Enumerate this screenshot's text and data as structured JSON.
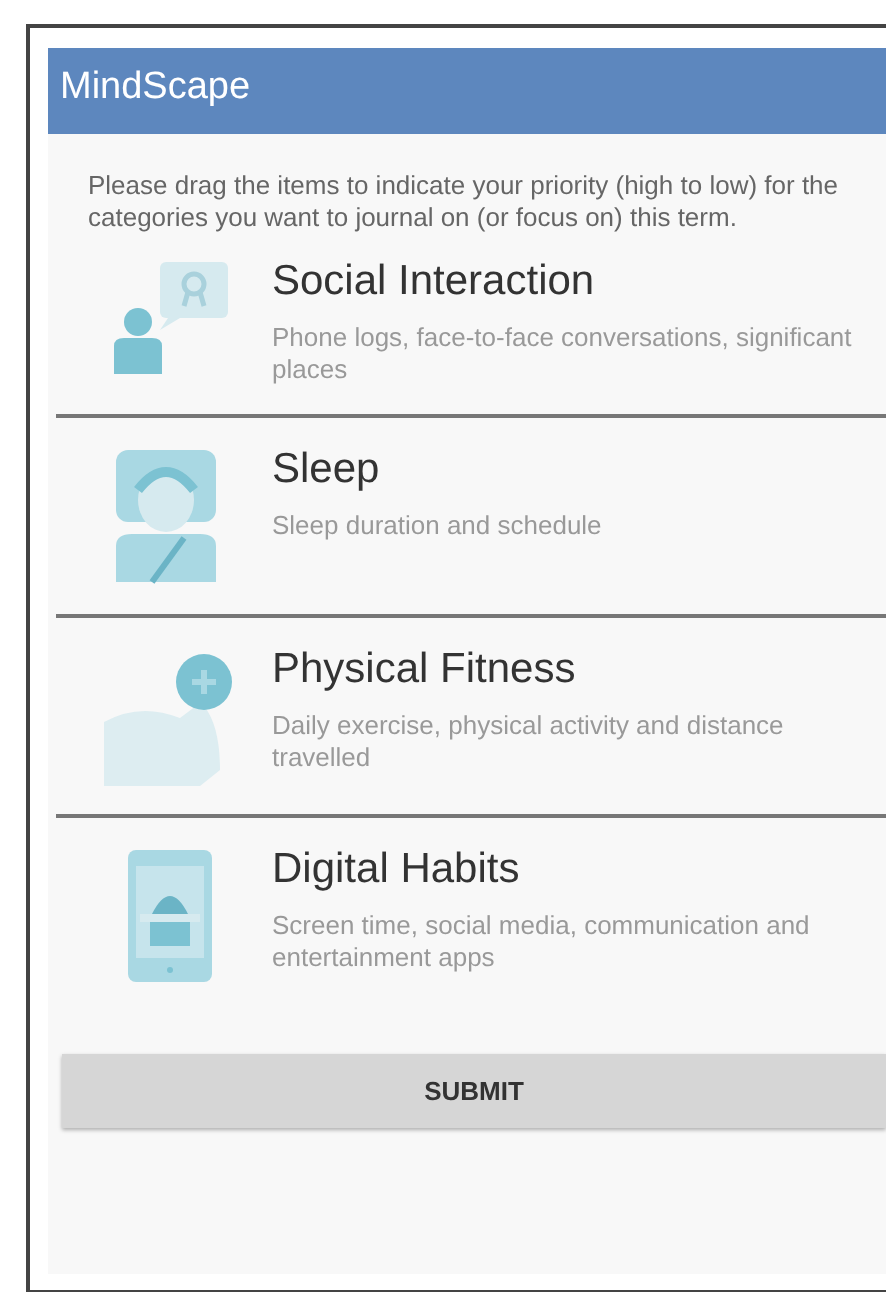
{
  "app_bar": {
    "title": "MindScape"
  },
  "instructions": "Please drag the items to indicate your priority (high to low) for the categories you want to journal on (or focus on) this term.",
  "items": [
    {
      "kind": "social",
      "title": "Social Interaction",
      "description": "Phone logs, face-to-face conversations, significant places"
    },
    {
      "kind": "sleep",
      "title": "Sleep",
      "description": "Sleep duration and schedule"
    },
    {
      "kind": "fitness",
      "title": "Physical Fitness",
      "description": "Daily exercise, physical activity and distance travelled"
    },
    {
      "kind": "digital",
      "title": "Digital Habits",
      "description": "Screen time, social media, communication and entertainment apps"
    }
  ],
  "submit_button": "SUBMIT"
}
